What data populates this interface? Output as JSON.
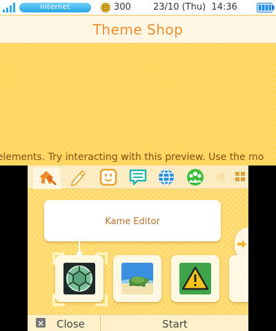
{
  "status_bar": {
    "connection_label": "Internet",
    "coin_count": "300",
    "datetime": "23/10 (Thu)  14:36",
    "icons": [
      "signal-icon",
      "coin-icon",
      "battery-icon"
    ]
  },
  "top": {
    "title": "Theme Shop",
    "marquee": "s elements.  Try interacting with this preview. Use the mo"
  },
  "toolbar": {
    "items": [
      "home-icon",
      "pencil-icon",
      "face-icon",
      "speech-bubble-icon",
      "globe-icon",
      "friends-icon",
      "grid-icon"
    ]
  },
  "main": {
    "selected_title": "Kame Editor",
    "tiles": [
      "shell-icon",
      "turtle-photo-icon",
      "warning-icon"
    ]
  },
  "bottom_bar": {
    "close_label": "Close",
    "start_label": "Start"
  },
  "colors": {
    "accent_orange": "#ef8d2c",
    "background_yellow": "#fed45a",
    "internet_blue": "#27a7e8"
  }
}
